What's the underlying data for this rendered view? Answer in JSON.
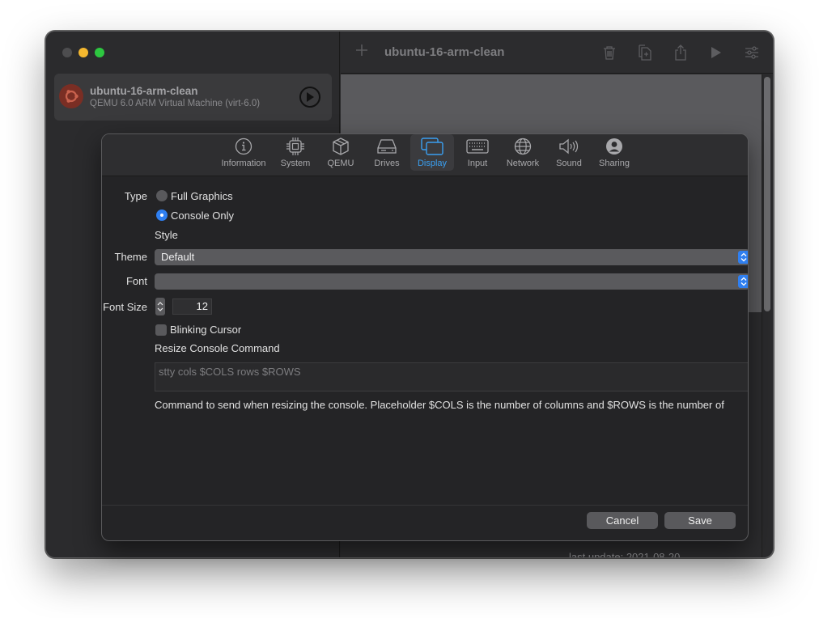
{
  "window": {
    "title": "ubuntu-16-arm-clean",
    "traffic_lights": {
      "close": "#4d4d4f",
      "minimize": "#f5b82f",
      "maximize": "#2dc740"
    }
  },
  "sidebar": {
    "items": [
      {
        "name": "ubuntu-16-arm-clean",
        "subtitle": "QEMU 6.0 ARM Virtual Machine (virt-6.0)",
        "icon": "ubuntu-logo-icon"
      }
    ]
  },
  "toolbar": {
    "add_icon": "plus-icon",
    "title": "ubuntu-16-arm-clean",
    "icons": [
      "trash-icon",
      "clone-icon",
      "share-icon",
      "play-icon",
      "settings-sliders-icon"
    ]
  },
  "main": {
    "last_update": "last update: 2021-08-20"
  },
  "settings": {
    "tabs": [
      {
        "label": "Information",
        "icon": "info-icon"
      },
      {
        "label": "System",
        "icon": "cpu-icon"
      },
      {
        "label": "QEMU",
        "icon": "cube-icon"
      },
      {
        "label": "Drives",
        "icon": "drive-icon"
      },
      {
        "label": "Display",
        "icon": "display-icon"
      },
      {
        "label": "Input",
        "icon": "keyboard-icon"
      },
      {
        "label": "Network",
        "icon": "globe-icon"
      },
      {
        "label": "Sound",
        "icon": "speaker-icon"
      },
      {
        "label": "Sharing",
        "icon": "person-icon"
      }
    ],
    "active_tab": "Display",
    "accent_color": "#3aa0f2",
    "display": {
      "type_label": "Type",
      "type_options": [
        "Full Graphics",
        "Console Only"
      ],
      "type_selected": "Console Only",
      "style_heading": "Style",
      "theme_label": "Theme",
      "theme_value": "Default",
      "font_label": "Font",
      "font_value": "",
      "font_size_label": "Font Size",
      "font_size_value": "12",
      "blinking_cursor_label": "Blinking Cursor",
      "blinking_cursor_checked": false,
      "resize_command_heading": "Resize Console Command",
      "resize_command_value": "stty cols $COLS rows $ROWS",
      "resize_command_help": "Command to send when resizing the console. Placeholder $COLS is the number of columns and $ROWS is the number of"
    },
    "buttons": {
      "cancel": "Cancel",
      "save": "Save"
    }
  }
}
